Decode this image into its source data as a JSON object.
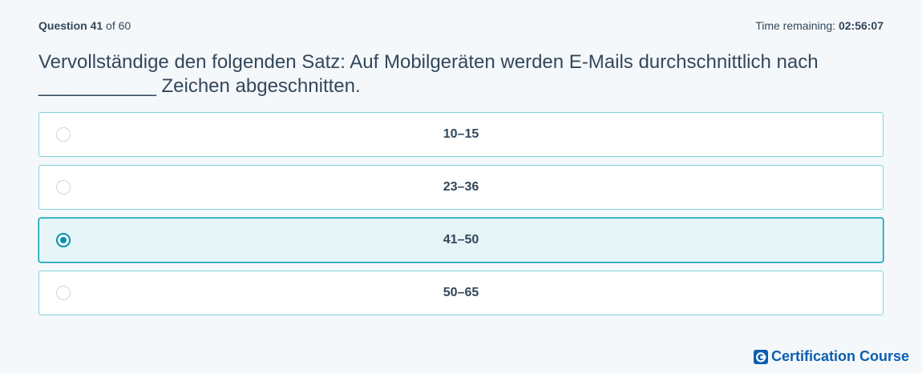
{
  "header": {
    "question_label": "Question",
    "question_number": "41",
    "of_label": "of",
    "question_total": "60",
    "time_label": "Time remaining:",
    "time_value": "02:56:07"
  },
  "question": {
    "line1": "Vervollständige den folgenden Satz: Auf Mobilgeräten werden E-Mails durchschnittlich nach",
    "line2": "___________ Zeichen abgeschnitten."
  },
  "options": [
    {
      "label": "10–15",
      "selected": false
    },
    {
      "label": "23–36",
      "selected": false
    },
    {
      "label": "41–50",
      "selected": true
    },
    {
      "label": "50–65",
      "selected": false
    }
  ],
  "brand": {
    "name": "Certification Course",
    "icon": "g-logo-icon"
  },
  "colors": {
    "accent": "#0091ae",
    "brand": "#0b5fb0",
    "text": "#33475b",
    "selected_bg": "#e5f5f8",
    "border": "#7fd1de"
  }
}
